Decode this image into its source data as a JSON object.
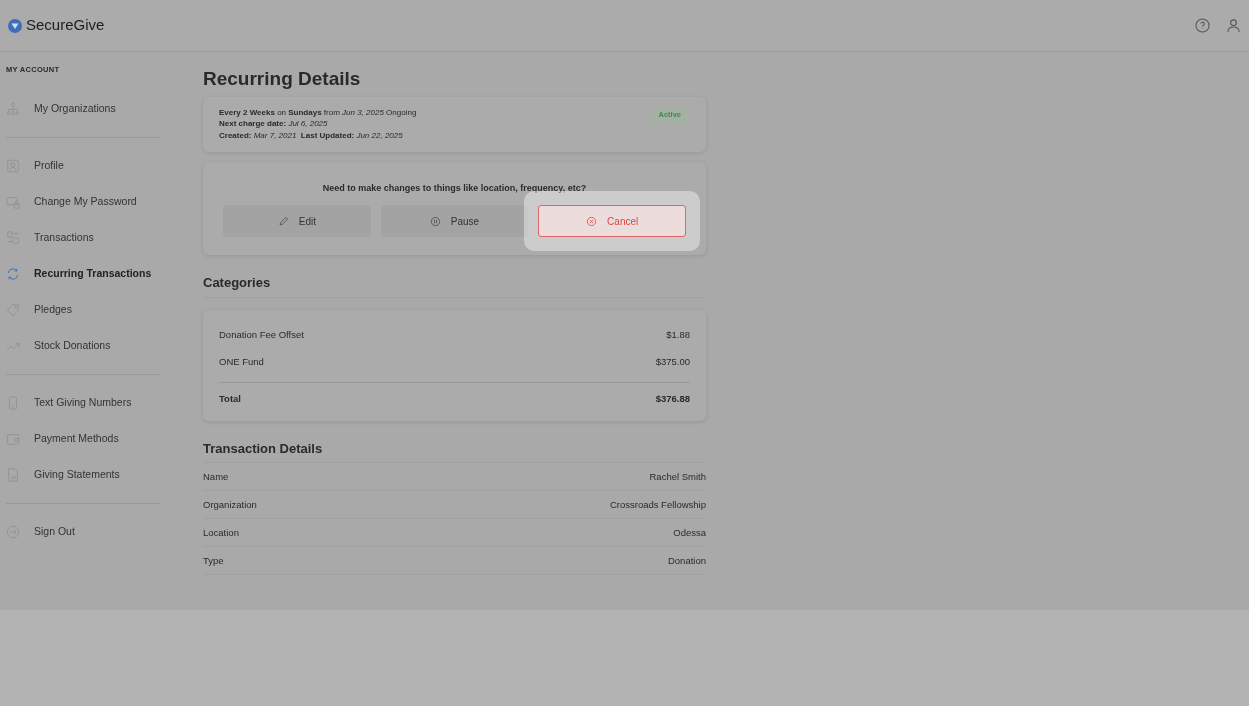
{
  "brand": "SecureGive",
  "sidebar": {
    "heading": "MY ACCOUNT",
    "groups": [
      [
        {
          "label": "My Organizations",
          "selected": false
        }
      ],
      [
        {
          "label": "Profile",
          "selected": false
        },
        {
          "label": "Change My Password",
          "selected": false
        },
        {
          "label": "Transactions",
          "selected": false
        },
        {
          "label": "Recurring Transactions",
          "selected": true
        },
        {
          "label": "Pledges",
          "selected": false
        },
        {
          "label": "Stock Donations",
          "selected": false
        }
      ],
      [
        {
          "label": "Text Giving Numbers",
          "selected": false
        },
        {
          "label": "Payment Methods",
          "selected": false
        },
        {
          "label": "Giving Statements",
          "selected": false
        }
      ],
      [
        {
          "label": "Sign Out",
          "selected": false
        }
      ]
    ]
  },
  "title": "Recurring Details",
  "summary": {
    "lines": [
      "**Every 2 Weeks** on **Sundays** from *Jun 3, 2025* Ongoing",
      "**Next charge date:** *Jul 6, 2025*",
      "**Created:** *Mar 7, 2021*  **Last Updated:** *Jun 22, 2025*"
    ],
    "status": "Active"
  },
  "changes": {
    "prompt": "Need to make changes to things like location, frequency, etc?",
    "buttons": [
      {
        "label": "Edit",
        "kind": "edit",
        "highlighted": false
      },
      {
        "label": "Pause",
        "kind": "pause",
        "highlighted": false
      },
      {
        "label": "Cancel",
        "kind": "cancel",
        "highlighted": true
      }
    ]
  },
  "categories": {
    "title": "Categories",
    "rows": [
      {
        "name": "Donation Fee Offset",
        "amount": "$1.88"
      },
      {
        "name": "ONE Fund",
        "amount": "$375.00"
      }
    ],
    "total": {
      "name": "Total",
      "amount": "$376.88"
    }
  },
  "details": {
    "title": "Transaction Details",
    "rows": [
      {
        "label": "Name",
        "value": "Rachel Smith"
      },
      {
        "label": "Organization",
        "value": "Crossroads Fellowship"
      },
      {
        "label": "Location",
        "value": "Odessa"
      },
      {
        "label": "Type",
        "value": "Donation"
      }
    ]
  }
}
